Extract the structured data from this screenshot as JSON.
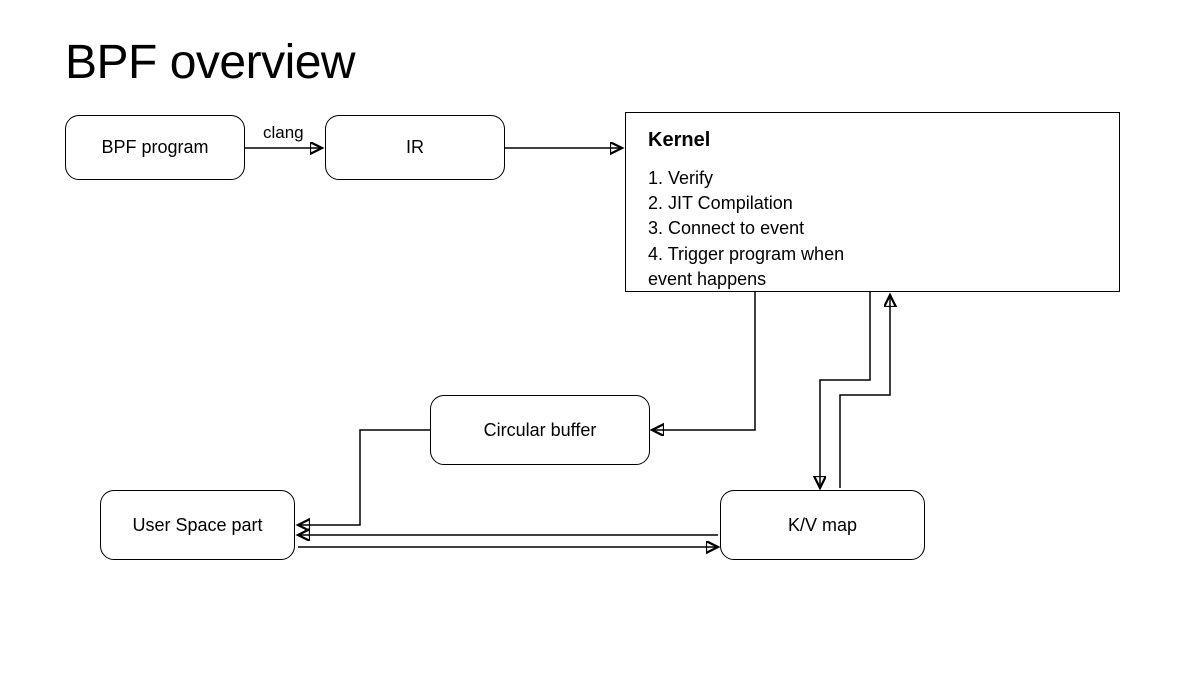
{
  "title": "BPF overview",
  "nodes": {
    "bpf_program": "BPF program",
    "ir": "IR",
    "kernel_title": "Kernel",
    "kernel_steps": [
      "1. Verify",
      "2. JIT Compilation",
      "3. Connect to event",
      "4. Trigger program when",
      "event happens"
    ],
    "circular_buffer": "Circular buffer",
    "user_space": "User Space part",
    "kv_map": "K/V map"
  },
  "edge_labels": {
    "clang": "clang"
  }
}
